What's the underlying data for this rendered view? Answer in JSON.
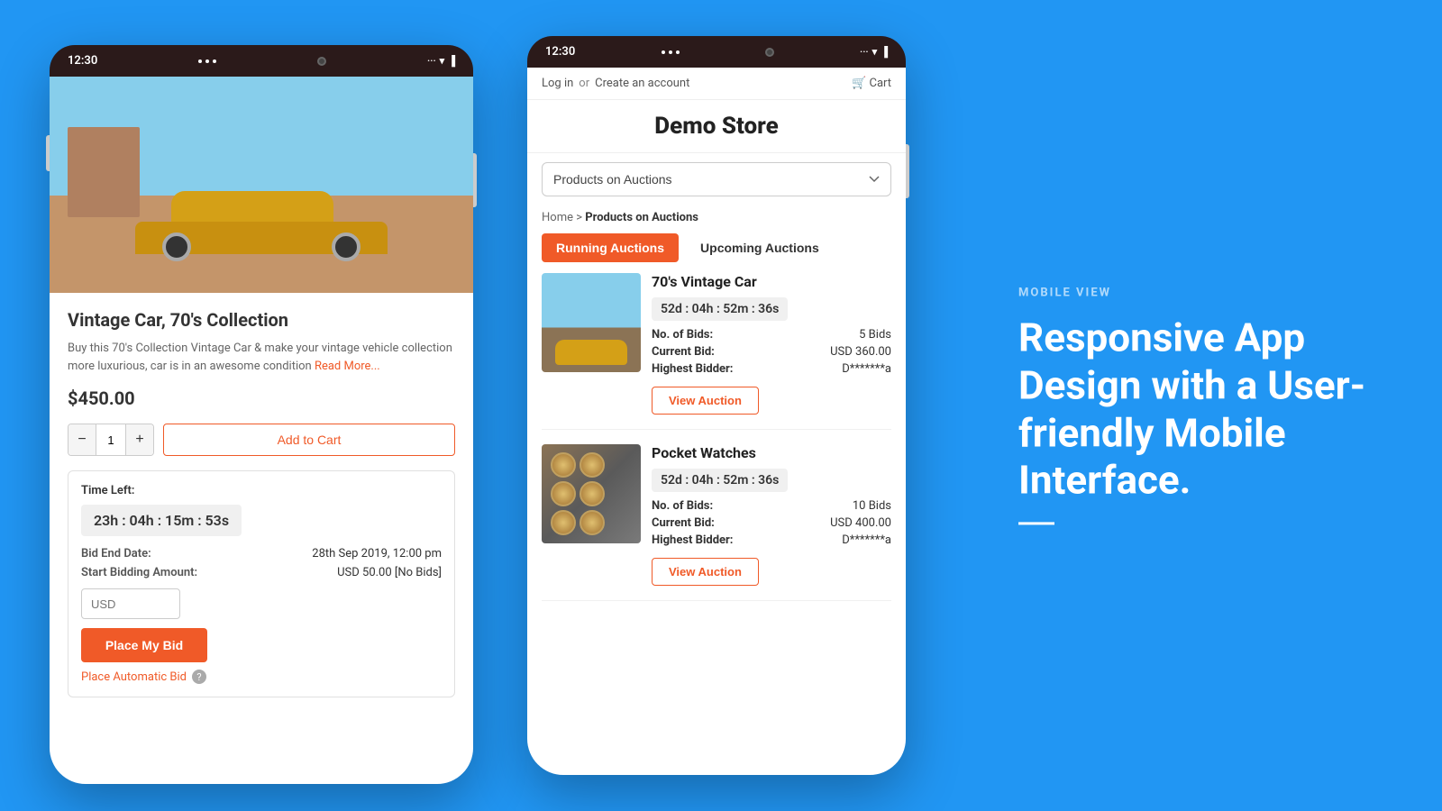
{
  "background_color": "#2196f3",
  "phone_left": {
    "status_time": "12:30",
    "product": {
      "title": "Vintage Car, 70's Collection",
      "description": "Buy this 70's Collection Vintage Car & make your vintage vehicle collection more luxurious, car is in an awesome condition",
      "read_more": "Read More...",
      "price": "$450.00",
      "quantity": "1",
      "add_to_cart_label": "Add to Cart",
      "bid_section": {
        "time_left_label": "Time Left:",
        "timer": "23h : 04h : 15m : 53s",
        "bid_end_label": "Bid End Date:",
        "bid_end_value": "28th Sep 2019, 12:00 pm",
        "start_bid_label": "Start Bidding Amount:",
        "start_bid_value": "USD 50.00  [No Bids]",
        "bid_input_placeholder": "USD",
        "place_bid_label": "Place My Bid",
        "auto_bid_label": "Place Automatic Bid"
      }
    }
  },
  "phone_right": {
    "status_time": "12:30",
    "nav": {
      "login": "Log in",
      "or": "or",
      "create": "Create an account",
      "cart": "Cart"
    },
    "store_title": "Demo Store",
    "dropdown_label": "Products on Auctions",
    "breadcrumb": {
      "home": "Home",
      "separator": ">",
      "current": "Products on Auctions"
    },
    "tabs": [
      {
        "label": "Running Auctions",
        "active": true
      },
      {
        "label": "Upcoming Auctions",
        "active": false
      }
    ],
    "auctions": [
      {
        "name": "70's Vintage Car",
        "timer": "52d : 04h : 52m : 36s",
        "bids_label": "No. of Bids:",
        "bids_value": "5 Bids",
        "current_bid_label": "Current Bid:",
        "current_bid_value": "USD 360.00",
        "highest_bidder_label": "Highest Bidder:",
        "highest_bidder_value": "D*******a",
        "view_btn": "View Auction"
      },
      {
        "name": "Pocket Watches",
        "timer": "52d : 04h : 52m : 36s",
        "bids_label": "No. of Bids:",
        "bids_value": "10 Bids",
        "current_bid_label": "Current Bid:",
        "current_bid_value": "USD 400.00",
        "highest_bidder_label": "Highest Bidder:",
        "highest_bidder_value": "D*******a",
        "view_btn": "View Auction"
      }
    ]
  },
  "right_panel": {
    "label": "MOBILE VIEW",
    "headline": "Responsive App Design with a User-friendly Mobile Interface."
  }
}
